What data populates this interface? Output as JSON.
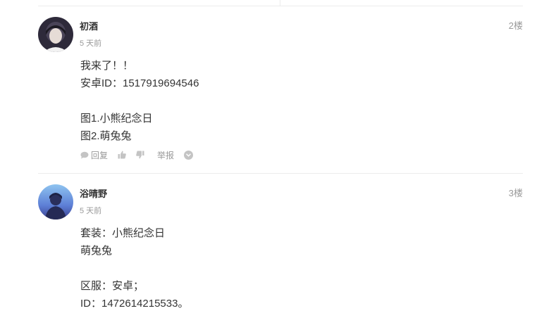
{
  "posts": [
    {
      "author": "初酒",
      "time": "5 天前",
      "floor": "2楼",
      "lines": [
        "我来了！！",
        "安卓ID：1517919694546",
        "",
        "图1.小熊纪念日",
        "图2.萌兔兔"
      ],
      "actions": {
        "reply": "回复",
        "report": "举报"
      }
    },
    {
      "author": "浴晴野",
      "time": "5 天前",
      "floor": "3楼",
      "lines": [
        "套装：小熊纪念日",
        "萌兔兔",
        "",
        "区服：安卓；",
        "ID：1472614215533。"
      ]
    }
  ],
  "icons": [
    "chat-bubble-icon",
    "thumbs-up-icon",
    "thumbs-down-icon",
    "chevron-down-icon"
  ],
  "colors": {
    "text": "#333333",
    "muted": "#999999",
    "icon": "#c4c4c4",
    "divider": "#ececec"
  }
}
